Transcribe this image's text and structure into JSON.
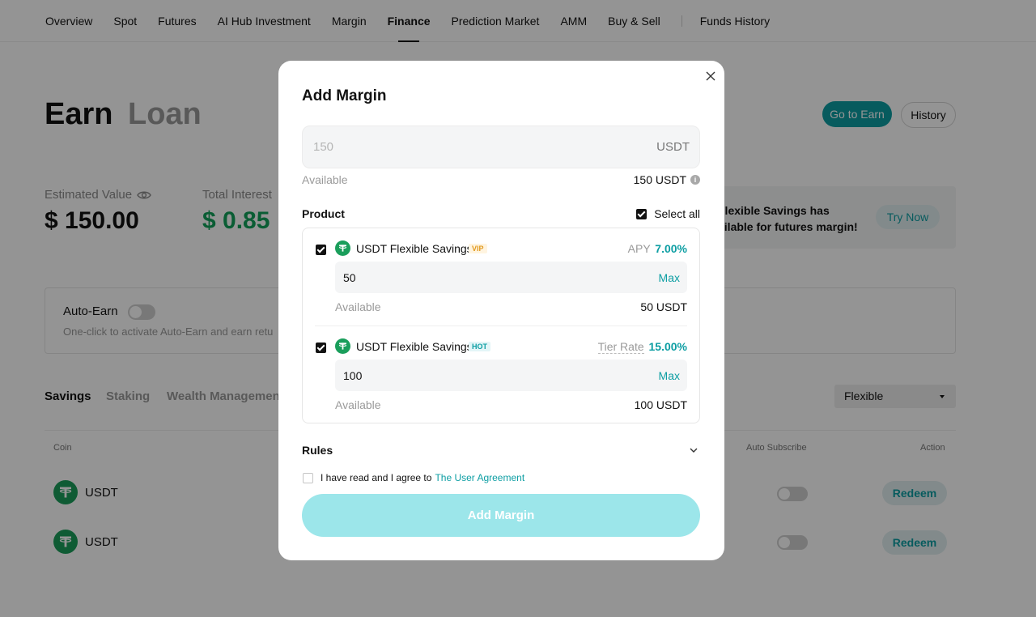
{
  "nav": {
    "items": [
      "Overview",
      "Spot",
      "Futures",
      "AI Hub Investment",
      "Margin",
      "Finance",
      "Prediction Market",
      "AMM",
      "Buy & Sell"
    ],
    "active": "Finance",
    "funds_history": "Funds History"
  },
  "page": {
    "earn_tab": "Earn",
    "loan_tab": "Loan",
    "go_to_earn": "Go to Earn",
    "history": "History",
    "estimated_value_label": "Estimated Value",
    "estimated_value": "$ 150.00",
    "total_interest_label": "Total Interest",
    "total_interest": "$ 0.85",
    "promo_line1": "Flexible Savings has",
    "promo_line2": "ailable for futures margin!",
    "try_now": "Try Now",
    "auto_earn_title": "Auto-Earn",
    "auto_earn_desc": "One-click to activate Auto-Earn and earn retu",
    "tabs": [
      "Savings",
      "Staking",
      "Wealth Managemen"
    ],
    "filter_select": "Flexible",
    "table_headers": {
      "coin": "Coin",
      "auto_subscribe": "Auto Subscribe",
      "action": "Action"
    },
    "rows": [
      {
        "coin": "USDT",
        "action": "Redeem"
      },
      {
        "coin": "USDT",
        "action": "Redeem"
      }
    ]
  },
  "modal": {
    "title": "Add Margin",
    "amount_placeholder": "150",
    "amount_unit": "USDT",
    "available_label": "Available",
    "available_value": "150 USDT",
    "product_label": "Product",
    "select_all_label": "Select all",
    "products": [
      {
        "name": "USDT Flexible Savings",
        "badge": "VIP",
        "rate_label": "APY",
        "rate_value": "7.00%",
        "amount": "50",
        "max_label": "Max",
        "available_label": "Available",
        "available_value": "50 USDT"
      },
      {
        "name": "USDT Flexible Savings",
        "badge": "HOT",
        "rate_label": "Tier Rate",
        "rate_value": "15.00%",
        "amount": "100",
        "max_label": "Max",
        "available_label": "Available",
        "available_value": "100 USDT"
      }
    ],
    "rules_label": "Rules",
    "agree_text": "I have read and I agree to",
    "agree_link": "The User Agreement",
    "submit_label": "Add Margin"
  },
  "colors": {
    "accent": "#0d9ea3",
    "positive": "#12a15a",
    "submit_disabled": "#9ce6ea"
  }
}
